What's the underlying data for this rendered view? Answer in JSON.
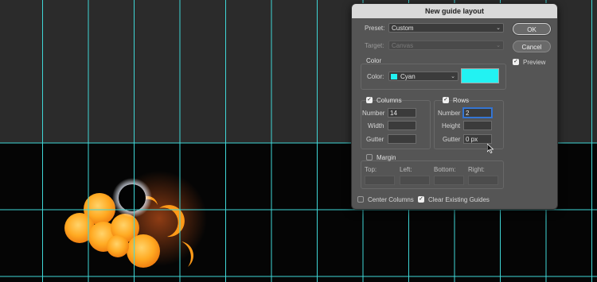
{
  "dialog": {
    "title": "New guide layout",
    "preset_label": "Preset:",
    "preset_value": "Custom",
    "target_label": "Target:",
    "target_value": "Canvas",
    "color_section": "Color",
    "color_label": "Color:",
    "color_value": "Cyan",
    "color_hex": "#22f2f2",
    "ok_label": "OK",
    "cancel_label": "Cancel",
    "preview_label": "Preview",
    "preview_checked": true,
    "columns": {
      "label": "Columns",
      "checked": true,
      "number_label": "Number",
      "number_value": "14",
      "width_label": "Width",
      "width_value": "",
      "gutter_label": "Gutter",
      "gutter_value": ""
    },
    "rows": {
      "label": "Rows",
      "checked": true,
      "number_label": "Number",
      "number_value": "2",
      "height_label": "Height",
      "height_value": "",
      "gutter_label": "Gutter",
      "gutter_value": "0 px"
    },
    "margin": {
      "label": "Margin",
      "checked": false,
      "top_label": "Top:",
      "left_label": "Left:",
      "bottom_label": "Bottom:",
      "right_label": "Right:"
    },
    "center_columns_label": "Center Columns",
    "center_columns_checked": false,
    "clear_guides_label": "Clear Existing Guides",
    "clear_guides_checked": true
  },
  "canvas": {
    "guide_color": "#3fd6d6",
    "document_background": "#050505"
  }
}
